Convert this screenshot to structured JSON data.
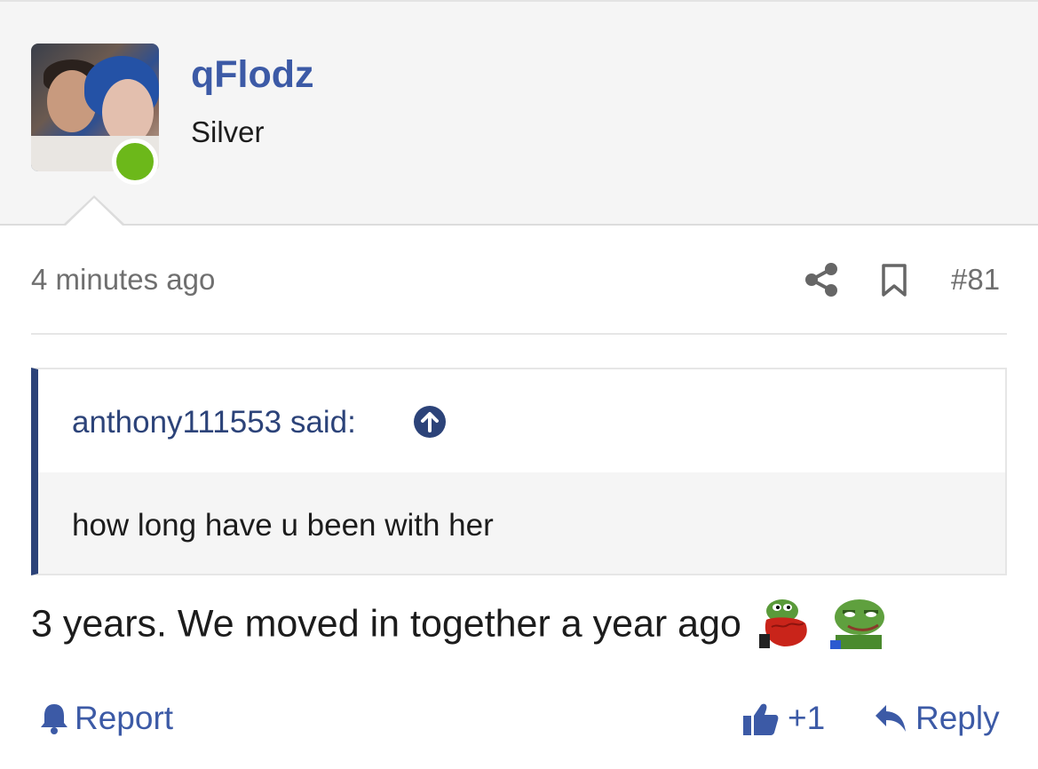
{
  "user": {
    "name": "qFlodz",
    "title": "Silver",
    "online": true,
    "online_color": "#6cb81a"
  },
  "post": {
    "timestamp": "4 minutes ago",
    "number": "#81",
    "message": "3 years. We moved in together a year ago",
    "emojis": [
      "pepe-red-blanket-emoji",
      "pepe-smug-emoji"
    ]
  },
  "quote": {
    "author": "anthony111553 said:",
    "body": "how long have u been with her"
  },
  "actions": {
    "report_label": "Report",
    "like_count": "+1",
    "reply_label": "Reply"
  },
  "colors": {
    "accent": "#3c5aa6",
    "quote_bar": "#2c4379",
    "muted": "#6f6f6f"
  }
}
